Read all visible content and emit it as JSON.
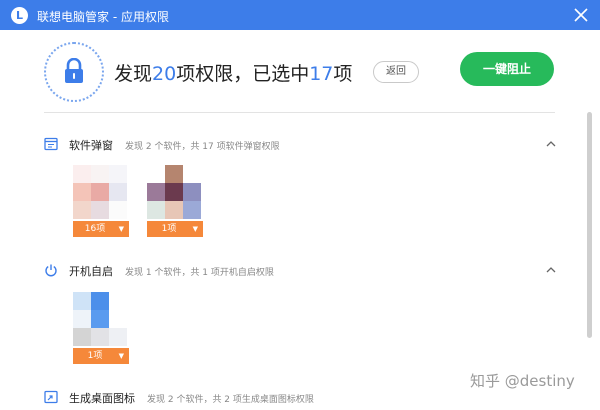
{
  "window": {
    "title": "联想电脑管家 - 应用权限",
    "logo_letter": "L"
  },
  "header": {
    "prefix": "发现",
    "total": "20",
    "middle": "项权限，已选中",
    "selected": "17",
    "suffix": "项",
    "back_label": "返回",
    "block_all_label": "一键阻止"
  },
  "sections": [
    {
      "name": "软件弹窗",
      "description": "发现 2 个软件，共 17 项软件弹窗权限",
      "apps": [
        {
          "count_label": "16项"
        },
        {
          "count_label": "1项"
        }
      ]
    },
    {
      "name": "开机自启",
      "description": "发现 1 个软件，共 1 项开机自启权限",
      "apps": [
        {
          "count_label": "1项"
        }
      ]
    },
    {
      "name": "生成桌面图标",
      "description": "发现 2 个软件，共 2 项生成桌面图标权限"
    }
  ],
  "watermark": "知乎 @destiny",
  "colors": {
    "accent": "#3d7de9",
    "block_button": "#27ba5b",
    "count_badge": "#f5883a"
  }
}
